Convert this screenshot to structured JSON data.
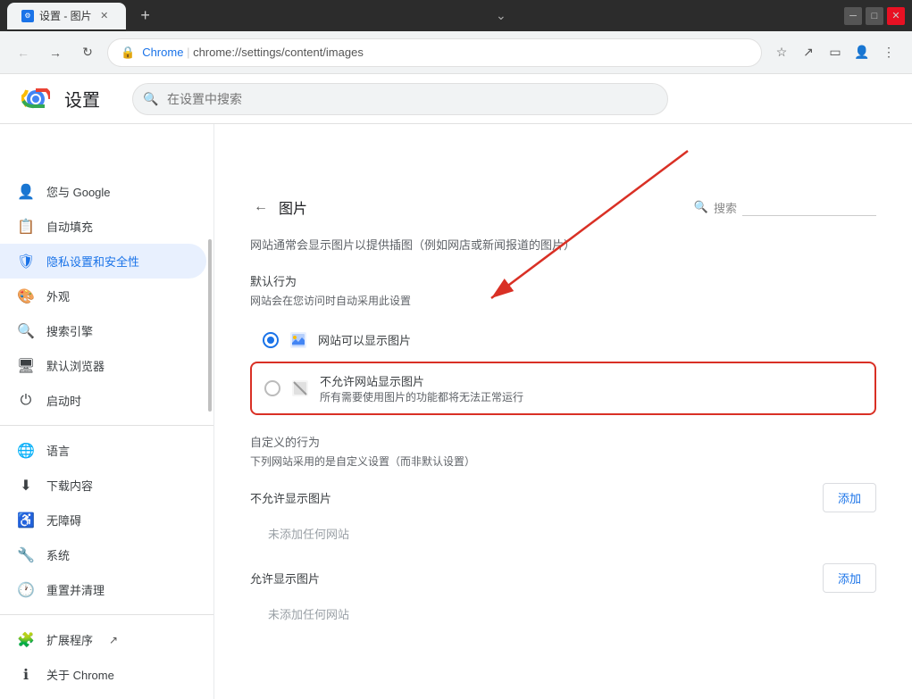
{
  "titlebar": {
    "tab_title": "设置 - 图片",
    "new_tab_tooltip": "新建标签页",
    "minimize": "─",
    "maximize": "□",
    "close": "✕"
  },
  "addressbar": {
    "url_prefix": "Chrome",
    "url_path": "chrome://settings/content/images",
    "back_icon": "←",
    "forward_icon": "→",
    "refresh_icon": "↻"
  },
  "settings": {
    "title": "设置",
    "search_placeholder": "在设置中搜索"
  },
  "sidebar": {
    "items": [
      {
        "id": "google",
        "icon": "👤",
        "label": "您与 Google"
      },
      {
        "id": "autofill",
        "icon": "📋",
        "label": "自动填充"
      },
      {
        "id": "privacy",
        "icon": "🛡",
        "label": "隐私设置和安全性",
        "active": true
      },
      {
        "id": "appearance",
        "icon": "🎨",
        "label": "外观"
      },
      {
        "id": "search",
        "icon": "🔍",
        "label": "搜索引擎"
      },
      {
        "id": "browser",
        "icon": "🖥",
        "label": "默认浏览器"
      },
      {
        "id": "startup",
        "icon": "⏻",
        "label": "启动时"
      },
      {
        "id": "language",
        "icon": "🌐",
        "label": "语言"
      },
      {
        "id": "download",
        "icon": "⬇",
        "label": "下载内容"
      },
      {
        "id": "accessibility",
        "icon": "♿",
        "label": "无障碍"
      },
      {
        "id": "system",
        "icon": "🔧",
        "label": "系统"
      },
      {
        "id": "reset",
        "icon": "🕐",
        "label": "重置并清理"
      },
      {
        "id": "extensions",
        "icon": "🧩",
        "label": "扩展程序"
      },
      {
        "id": "about",
        "icon": "ℹ",
        "label": "关于 Chrome"
      }
    ]
  },
  "content": {
    "back_icon": "←",
    "page_title": "图片",
    "search_label": "搜索",
    "description": "网站通常会显示图片以提供插图（例如网店或新闻报道的图片）",
    "default_behavior_label": "默认行为",
    "default_behavior_sub": "网站会在您访问时自动采用此设置",
    "option_allow_label": "网站可以显示图片",
    "option_block_label": "不允许网站显示图片",
    "option_block_sub": "所有需要使用图片的功能都将无法正常运行",
    "custom_behavior_label": "自定义的行为",
    "custom_behavior_sub": "下列网站采用的是自定义设置（而非默认设置）",
    "block_images_label": "不允许显示图片",
    "block_images_empty": "未添加任何网站",
    "allow_images_label": "允许显示图片",
    "allow_images_empty": "未添加任何网站",
    "add_label": "添加"
  }
}
